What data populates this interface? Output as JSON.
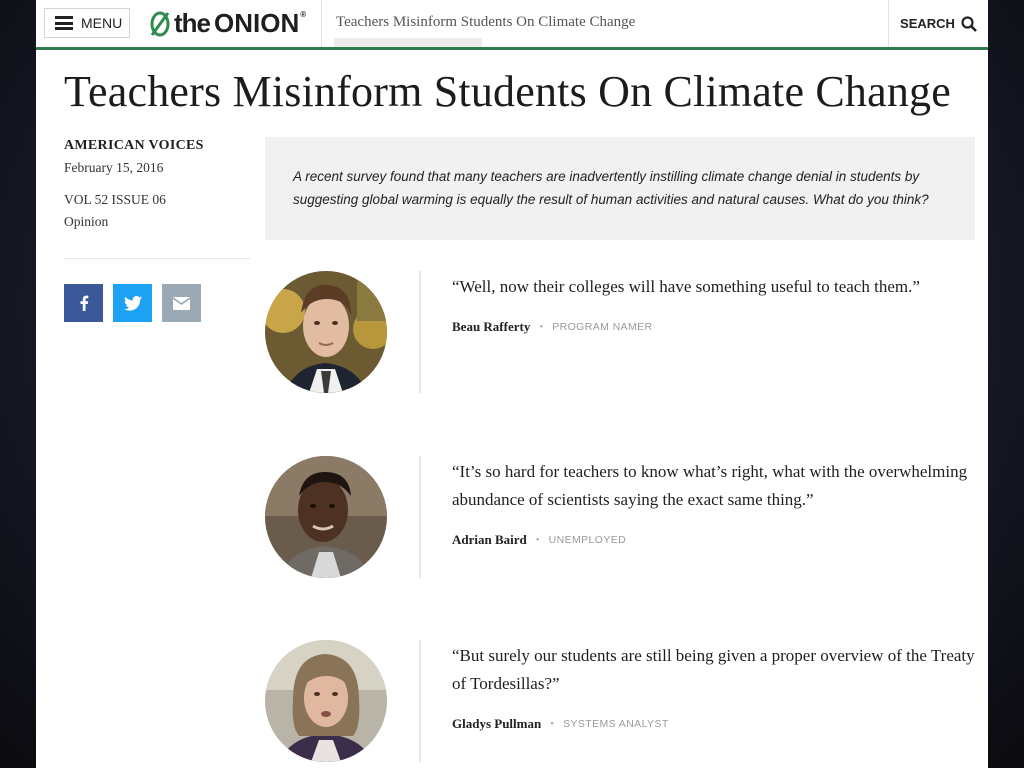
{
  "header": {
    "menu_label": "MENU",
    "logo_the": "the",
    "logo_onion": "ONION",
    "logo_reg": "®",
    "article_title": "Teachers Misinform Students On Climate Change",
    "search_label": "SEARCH"
  },
  "article": {
    "headline": "Teachers Misinform Students On Climate Change",
    "section": "AMERICAN VOICES",
    "date": "February 15, 2016",
    "volume": "VOL 52 ISSUE 06",
    "category": "Opinion",
    "summary": "A recent survey found that many teachers are inadvertently instilling climate change denial in students by suggesting global warming is equally the result of human activities and natural causes. What do you think?"
  },
  "share": {
    "icons": [
      "facebook-icon",
      "twitter-icon",
      "email-icon"
    ],
    "colors": {
      "facebook": "#3b5998",
      "twitter": "#1da1f2",
      "email": "#9aa9b3"
    }
  },
  "responses": [
    {
      "quote": "“Well, now their colleges will have something useful to teach them.”",
      "name": "Beau Rafferty",
      "job": "PROGRAM NAMER"
    },
    {
      "quote": "“It’s so hard for teachers to know what’s right, what with the overwhelming abundance of scientists saying the exact same thing.”",
      "name": "Adrian Baird",
      "job": "UNEMPLOYED"
    },
    {
      "quote": "“But surely our students are still being given a proper overview of the Treaty of Tordesillas?”",
      "name": "Gladys Pullman",
      "job": "SYSTEMS ANALYST"
    }
  ],
  "colors": {
    "accent_green": "#2f7a4f",
    "summary_bg": "#f1f1f1"
  }
}
